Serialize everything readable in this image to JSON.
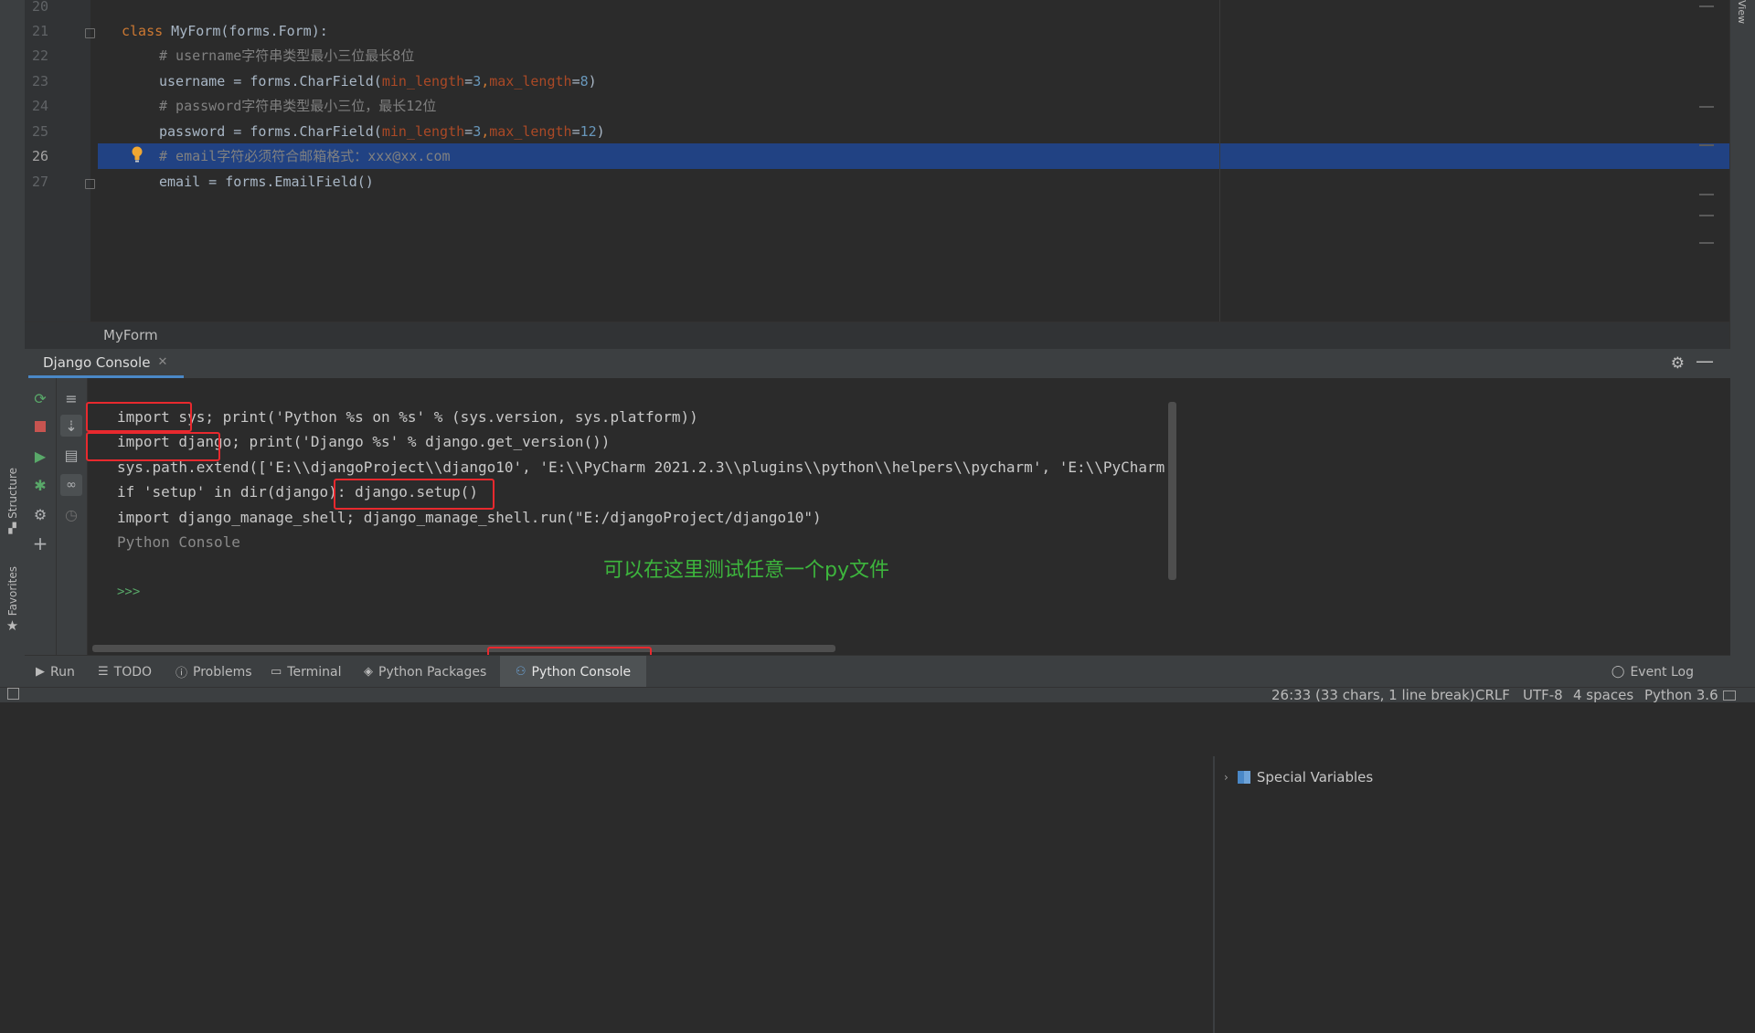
{
  "editor": {
    "lines": [
      {
        "n": "20"
      },
      {
        "n": "21",
        "kw": "class",
        "text": " MyForm(forms.Form):"
      },
      {
        "n": "22",
        "comment": "# username字符串类型最小三位最长8位"
      },
      {
        "n": "23",
        "a": "username = forms.CharField(",
        "p1": "min_length",
        "eq1": "=",
        "v1": "3",
        "sep": ",",
        "p2": "max_length",
        "eq2": "=",
        "v2": "8",
        "end": ")"
      },
      {
        "n": "24",
        "comment": "# password字符串类型最小三位，最长12位"
      },
      {
        "n": "25",
        "a": "password = forms.CharField(",
        "p1": "min_length",
        "eq1": "=",
        "v1": "3",
        "sep": ",",
        "p2": "max_length",
        "eq2": "=",
        "v2": "12",
        "end": ")"
      },
      {
        "n": "26",
        "comment": "# email字符必须符合邮箱格式：xxx@xx.com"
      },
      {
        "n": "27",
        "text": "email = forms.EmailField()"
      }
    ],
    "breadcrumb": "MyForm",
    "current_line": 26
  },
  "console": {
    "tab_label": "Django Console",
    "lines": [
      "import sys; print('Python %s on %s' % (sys.version, sys.platform))",
      "import django; print('Django %s' % django.get_version())",
      "sys.path.extend(['E:\\\\djangoProject\\\\django10', 'E:\\\\PyCharm 2021.2.3\\\\plugins\\\\python\\\\helpers\\\\pycharm', 'E:\\\\PyCharm",
      "if 'setup' in dir(django): django.setup()",
      "import django_manage_shell; django_manage_shell.run(\"E:/djangoProject/django10\")",
      "Python Console",
      "",
      ">>>"
    ],
    "annotation": "可以在这里测试任意一个py文件",
    "special_variables": "Special Variables"
  },
  "left_strip": {
    "structure": "Structure",
    "favorites": "Favorites"
  },
  "right_strip": {
    "view": "View"
  },
  "bottom_tabs": [
    {
      "label": "Run",
      "icon": "run-icon"
    },
    {
      "label": "TODO",
      "icon": "list-icon"
    },
    {
      "label": "Problems",
      "icon": "problems-icon"
    },
    {
      "label": "Terminal",
      "icon": "terminal-icon"
    },
    {
      "label": "Python Packages",
      "icon": "packages-icon"
    },
    {
      "label": "Python Console",
      "icon": "python-icon"
    }
  ],
  "event_log": "Event Log",
  "status": {
    "position": "26:33 (33 chars, 1 line break)",
    "line_sep": "CRLF",
    "encoding": "UTF-8",
    "indent": "4 spaces",
    "interpreter": "Python 3.6"
  },
  "colors": {
    "selection": "#214283",
    "highlight_box": "#e8292e",
    "annotation": "#3db53d",
    "accent_tab": "#4a88c7"
  }
}
